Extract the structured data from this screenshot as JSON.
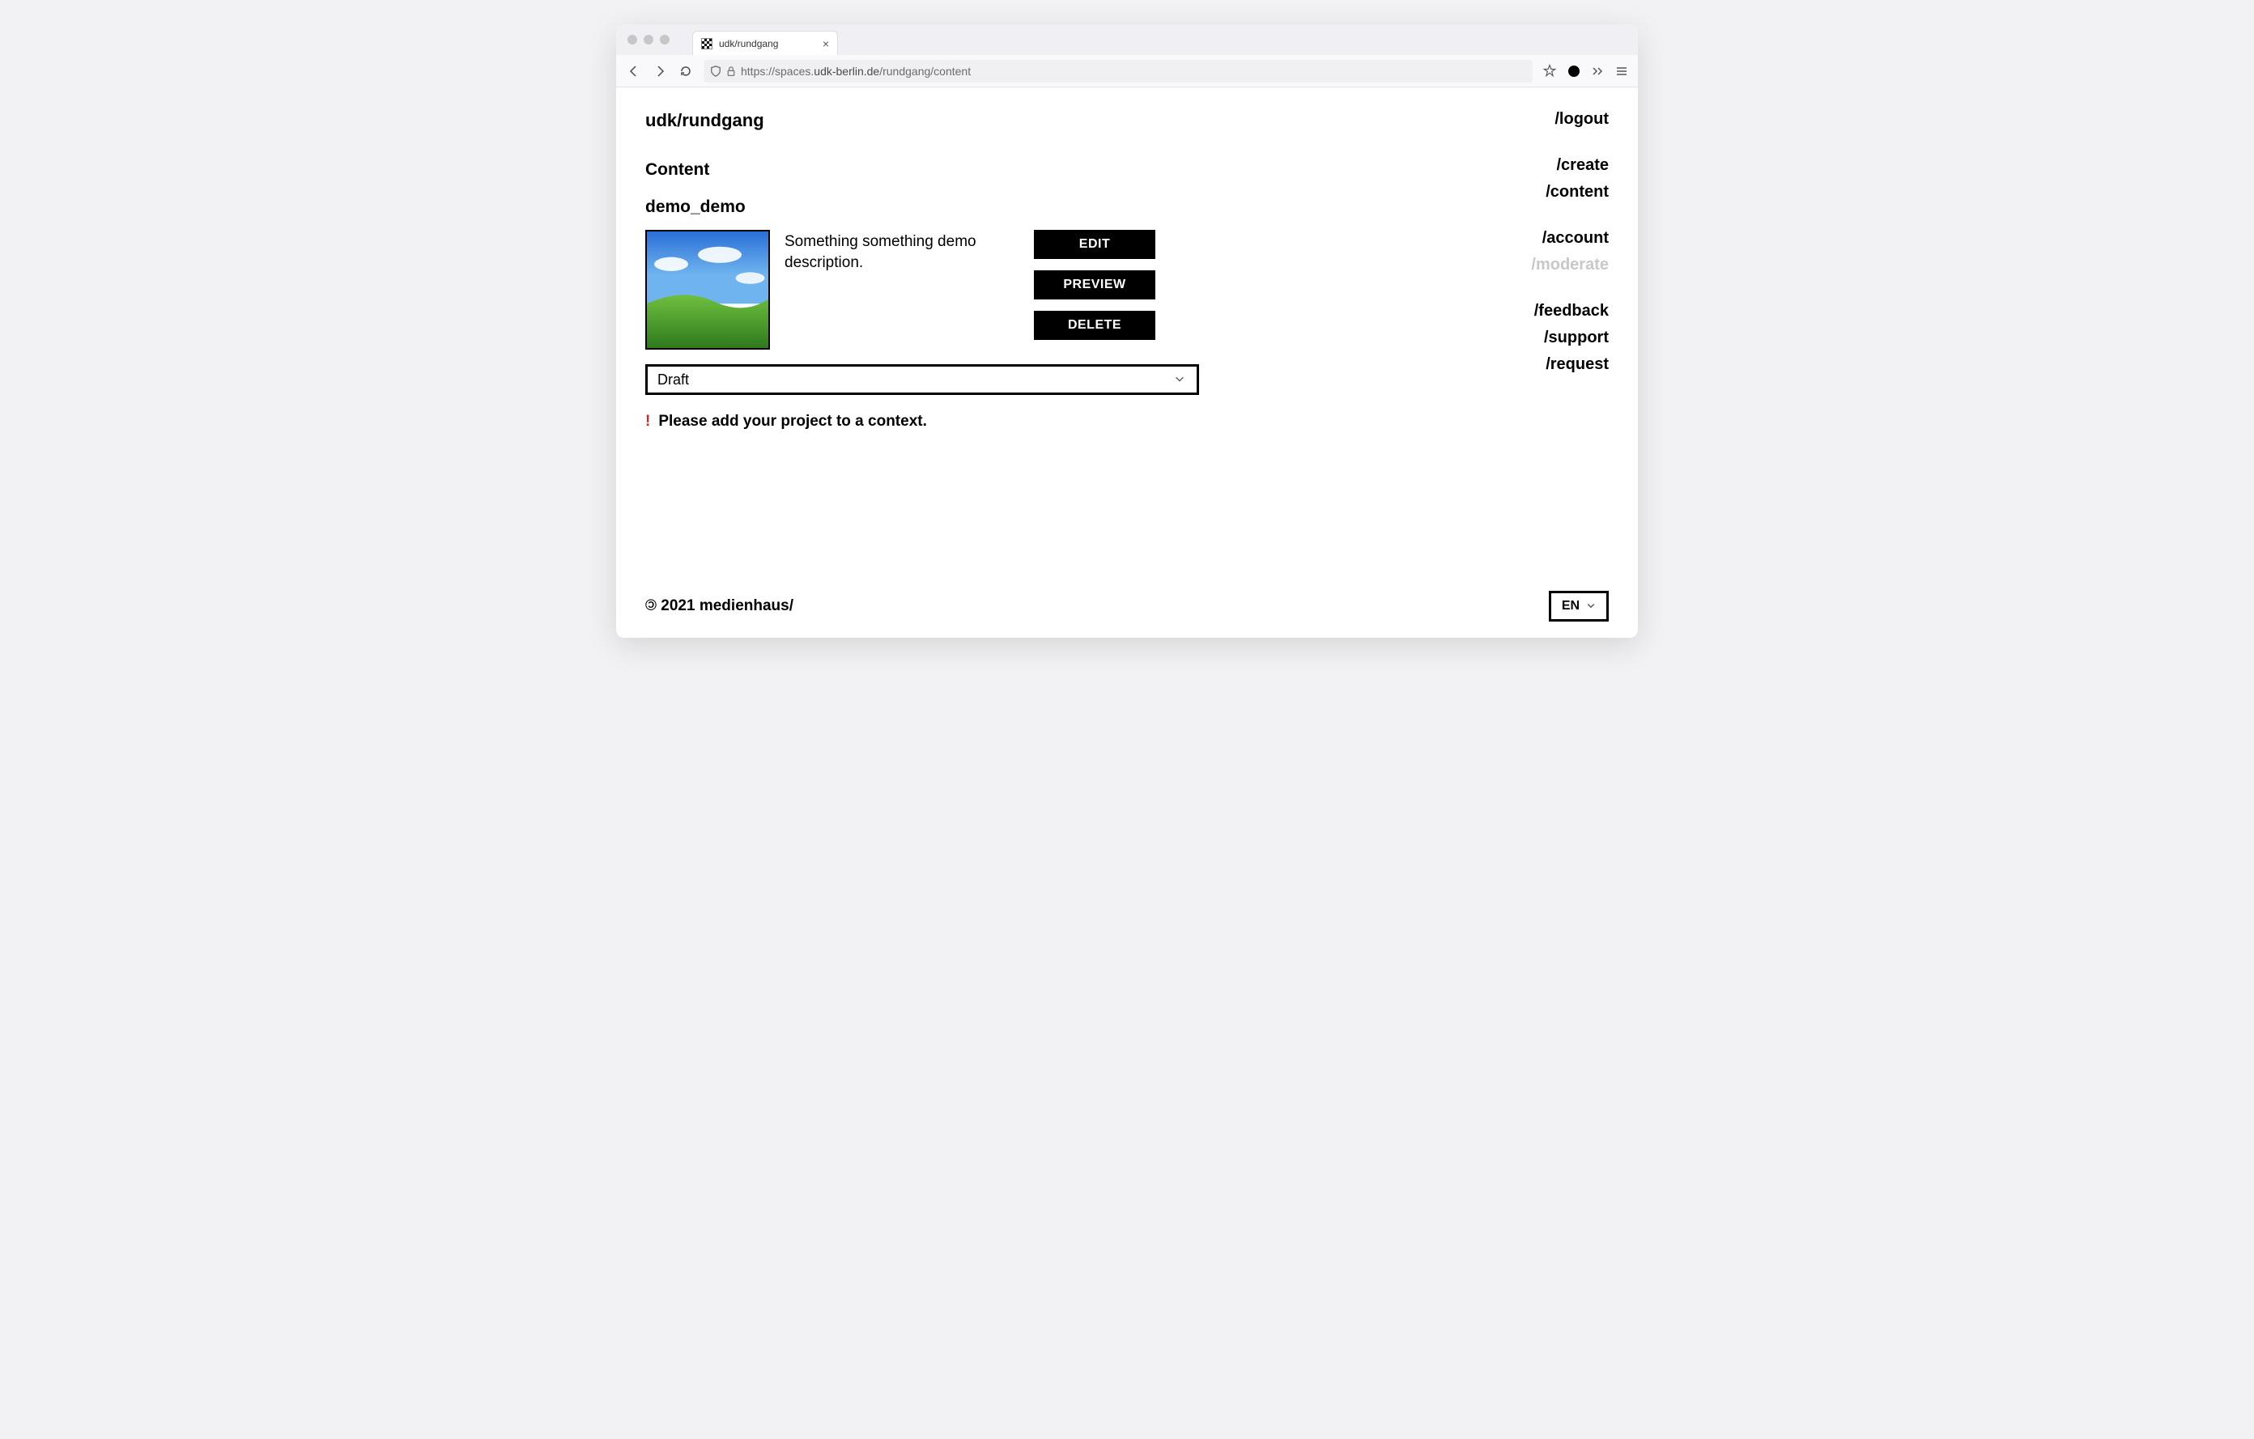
{
  "browser": {
    "tab_title": "udk/rundgang",
    "url_display": "https://spaces.udk-berlin.de/rundgang/content",
    "url_host": "udk-berlin.de",
    "url_prefix": "https://spaces.",
    "url_suffix": "/rundgang/content"
  },
  "header": {
    "site_title": "udk/rundgang"
  },
  "main": {
    "section_title": "Content",
    "project_title": "demo_demo",
    "description": "Something something demo description.",
    "actions": {
      "edit": "EDIT",
      "preview": "PREVIEW",
      "delete": "DELETE"
    },
    "status_selected": "Draft",
    "warning_text": "Please add your project to a context."
  },
  "sidebar": {
    "logout": "/logout",
    "group1": [
      "/create",
      "/content"
    ],
    "group2": [
      "/account",
      "/moderate"
    ],
    "group2_disabled_index": 1,
    "group3": [
      "/feedback",
      "/support",
      "/request"
    ]
  },
  "footer": {
    "year": "2021",
    "brand": "medienhaus/",
    "language": "EN"
  }
}
